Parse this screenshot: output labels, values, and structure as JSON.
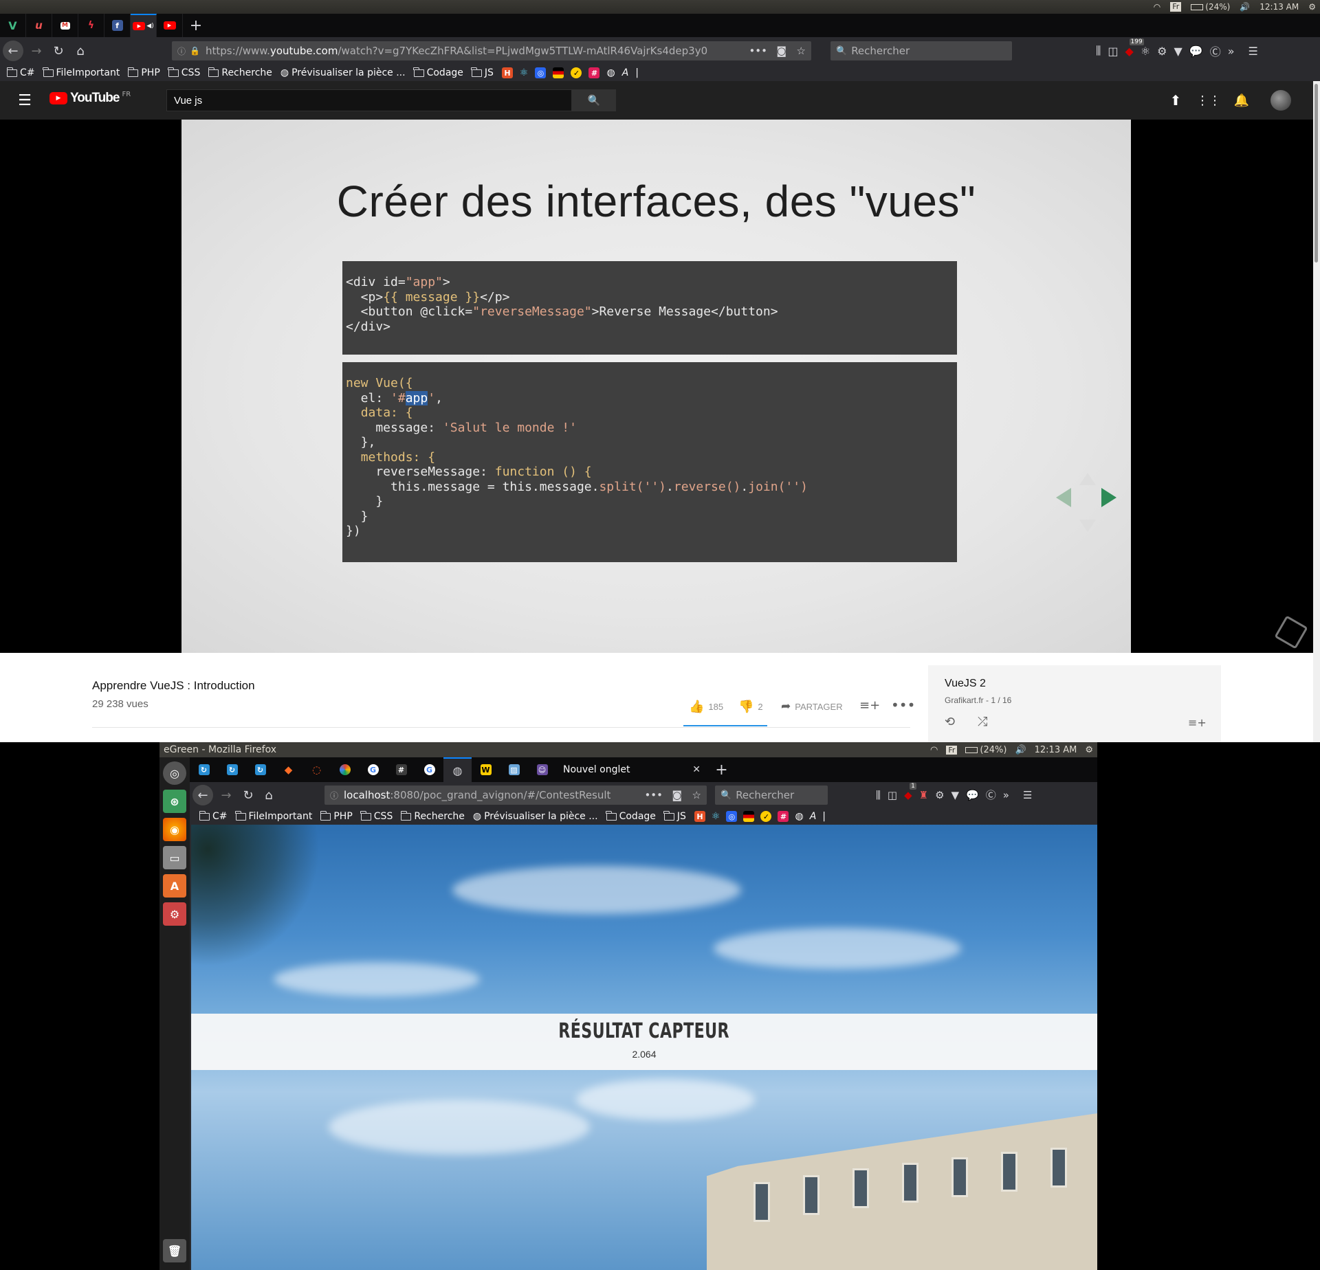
{
  "system_panel": {
    "keyboard": "Fr",
    "battery": "(24%)",
    "time": "12:13 AM"
  },
  "browser1": {
    "url_prefix": "https://www.",
    "url_host": "youtube.com",
    "url_path": "/watch?v=g7YKecZhFRA&list=PLjwdMgw5TTLW-mAtlR46VajrKs4dep3y0",
    "search_placeholder": "Rechercher",
    "toolbar_badge": "199",
    "bookmarks": [
      "C#",
      "FileImportant",
      "PHP",
      "CSS",
      "Recherche",
      "Prévisualiser la pièce ...",
      "Codage",
      "JS"
    ]
  },
  "youtube": {
    "logo_text": "YouTube",
    "logo_region": "FR",
    "search_value": "Vue js",
    "slide": {
      "title": "Créer des interfaces, des \"vues\""
    },
    "video_title": "Apprendre VueJS : Introduction",
    "views": "29 238 vues",
    "likes": "185",
    "dislikes": "2",
    "share_label": "PARTAGER",
    "playlist": {
      "title": "VueJS 2",
      "meta": "Grafikart.fr - 1 / 16"
    }
  },
  "window2": {
    "title": "eGreen - Mozilla Firefox",
    "keyboard": "Fr",
    "battery": "(24%)",
    "time": "12:13 AM",
    "active_tab": "Nouvel onglet",
    "url_host": "localhost",
    "url_rest": ":8080/poc_grand_avignon/#/ContestResult",
    "search_placeholder": "Rechercher",
    "toolbar_badge": "1",
    "bookmarks": [
      "C#",
      "FileImportant",
      "PHP",
      "CSS",
      "Recherche",
      "Prévisualiser la pièce ...",
      "Codage",
      "JS"
    ]
  },
  "app": {
    "result_title": "RÉSULTAT CAPTEUR",
    "result_value": "2.064"
  },
  "colors": {
    "youtube_red": "#ff0000",
    "firefox_blue": "#0a84ff",
    "code_bg": "#3f3f3f"
  }
}
